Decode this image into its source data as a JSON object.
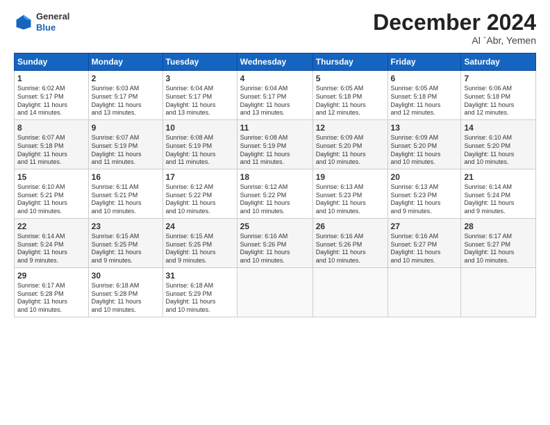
{
  "header": {
    "logo_line1": "General",
    "logo_line2": "Blue",
    "month": "December 2024",
    "location": "Al `Abr, Yemen"
  },
  "days_of_week": [
    "Sunday",
    "Monday",
    "Tuesday",
    "Wednesday",
    "Thursday",
    "Friday",
    "Saturday"
  ],
  "weeks": [
    [
      {
        "day": "1",
        "info": "Sunrise: 6:02 AM\nSunset: 5:17 PM\nDaylight: 11 hours\nand 14 minutes."
      },
      {
        "day": "2",
        "info": "Sunrise: 6:03 AM\nSunset: 5:17 PM\nDaylight: 11 hours\nand 13 minutes."
      },
      {
        "day": "3",
        "info": "Sunrise: 6:04 AM\nSunset: 5:17 PM\nDaylight: 11 hours\nand 13 minutes."
      },
      {
        "day": "4",
        "info": "Sunrise: 6:04 AM\nSunset: 5:17 PM\nDaylight: 11 hours\nand 13 minutes."
      },
      {
        "day": "5",
        "info": "Sunrise: 6:05 AM\nSunset: 5:18 PM\nDaylight: 11 hours\nand 12 minutes."
      },
      {
        "day": "6",
        "info": "Sunrise: 6:05 AM\nSunset: 5:18 PM\nDaylight: 11 hours\nand 12 minutes."
      },
      {
        "day": "7",
        "info": "Sunrise: 6:06 AM\nSunset: 5:18 PM\nDaylight: 11 hours\nand 12 minutes."
      }
    ],
    [
      {
        "day": "8",
        "info": "Sunrise: 6:07 AM\nSunset: 5:18 PM\nDaylight: 11 hours\nand 11 minutes."
      },
      {
        "day": "9",
        "info": "Sunrise: 6:07 AM\nSunset: 5:19 PM\nDaylight: 11 hours\nand 11 minutes."
      },
      {
        "day": "10",
        "info": "Sunrise: 6:08 AM\nSunset: 5:19 PM\nDaylight: 11 hours\nand 11 minutes."
      },
      {
        "day": "11",
        "info": "Sunrise: 6:08 AM\nSunset: 5:19 PM\nDaylight: 11 hours\nand 11 minutes."
      },
      {
        "day": "12",
        "info": "Sunrise: 6:09 AM\nSunset: 5:20 PM\nDaylight: 11 hours\nand 10 minutes."
      },
      {
        "day": "13",
        "info": "Sunrise: 6:09 AM\nSunset: 5:20 PM\nDaylight: 11 hours\nand 10 minutes."
      },
      {
        "day": "14",
        "info": "Sunrise: 6:10 AM\nSunset: 5:20 PM\nDaylight: 11 hours\nand 10 minutes."
      }
    ],
    [
      {
        "day": "15",
        "info": "Sunrise: 6:10 AM\nSunset: 5:21 PM\nDaylight: 11 hours\nand 10 minutes."
      },
      {
        "day": "16",
        "info": "Sunrise: 6:11 AM\nSunset: 5:21 PM\nDaylight: 11 hours\nand 10 minutes."
      },
      {
        "day": "17",
        "info": "Sunrise: 6:12 AM\nSunset: 5:22 PM\nDaylight: 11 hours\nand 10 minutes."
      },
      {
        "day": "18",
        "info": "Sunrise: 6:12 AM\nSunset: 5:22 PM\nDaylight: 11 hours\nand 10 minutes."
      },
      {
        "day": "19",
        "info": "Sunrise: 6:13 AM\nSunset: 5:23 PM\nDaylight: 11 hours\nand 10 minutes."
      },
      {
        "day": "20",
        "info": "Sunrise: 6:13 AM\nSunset: 5:23 PM\nDaylight: 11 hours\nand 9 minutes."
      },
      {
        "day": "21",
        "info": "Sunrise: 6:14 AM\nSunset: 5:24 PM\nDaylight: 11 hours\nand 9 minutes."
      }
    ],
    [
      {
        "day": "22",
        "info": "Sunrise: 6:14 AM\nSunset: 5:24 PM\nDaylight: 11 hours\nand 9 minutes."
      },
      {
        "day": "23",
        "info": "Sunrise: 6:15 AM\nSunset: 5:25 PM\nDaylight: 11 hours\nand 9 minutes."
      },
      {
        "day": "24",
        "info": "Sunrise: 6:15 AM\nSunset: 5:25 PM\nDaylight: 11 hours\nand 9 minutes."
      },
      {
        "day": "25",
        "info": "Sunrise: 6:16 AM\nSunset: 5:26 PM\nDaylight: 11 hours\nand 10 minutes."
      },
      {
        "day": "26",
        "info": "Sunrise: 6:16 AM\nSunset: 5:26 PM\nDaylight: 11 hours\nand 10 minutes."
      },
      {
        "day": "27",
        "info": "Sunrise: 6:16 AM\nSunset: 5:27 PM\nDaylight: 11 hours\nand 10 minutes."
      },
      {
        "day": "28",
        "info": "Sunrise: 6:17 AM\nSunset: 5:27 PM\nDaylight: 11 hours\nand 10 minutes."
      }
    ],
    [
      {
        "day": "29",
        "info": "Sunrise: 6:17 AM\nSunset: 5:28 PM\nDaylight: 11 hours\nand 10 minutes."
      },
      {
        "day": "30",
        "info": "Sunrise: 6:18 AM\nSunset: 5:28 PM\nDaylight: 11 hours\nand 10 minutes."
      },
      {
        "day": "31",
        "info": "Sunrise: 6:18 AM\nSunset: 5:29 PM\nDaylight: 11 hours\nand 10 minutes."
      },
      {
        "day": "",
        "info": ""
      },
      {
        "day": "",
        "info": ""
      },
      {
        "day": "",
        "info": ""
      },
      {
        "day": "",
        "info": ""
      }
    ]
  ]
}
